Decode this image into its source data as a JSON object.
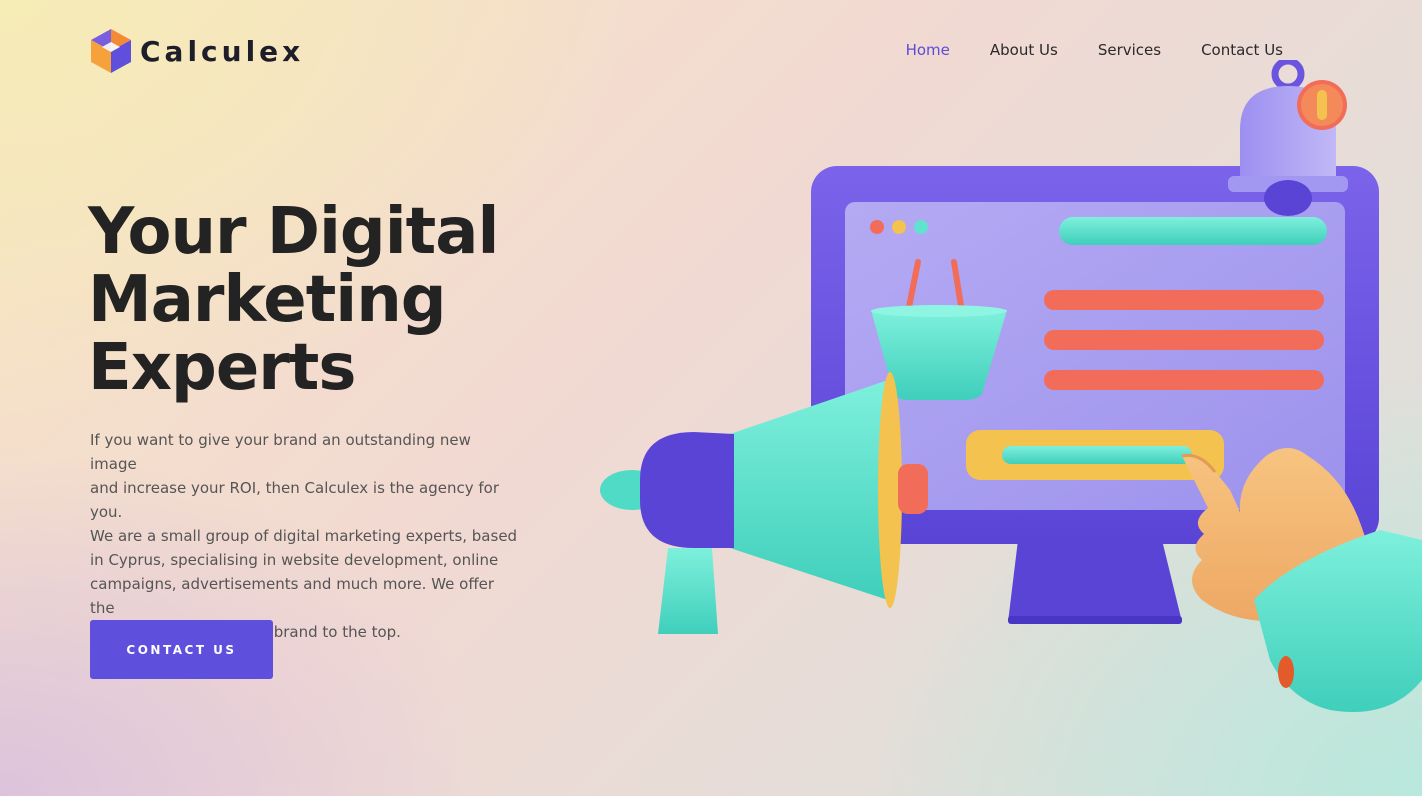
{
  "brand": {
    "name": "Calculex",
    "logo_icon": "hexagon-cube-icon"
  },
  "nav": {
    "items": [
      {
        "label": "Home",
        "active": true
      },
      {
        "label": "About Us",
        "active": false
      },
      {
        "label": "Services",
        "active": false
      },
      {
        "label": "Contact Us",
        "active": false
      }
    ]
  },
  "hero": {
    "title_lines": [
      "Your Digital",
      "Marketing",
      "Experts"
    ],
    "body_lines": [
      "If you want to give your brand an outstanding new image",
      "and increase your ROI, then Calculex is the agency for you.",
      "We are a small group of digital marketing experts, based",
      "in Cyprus, specialising in website development, online",
      "campaigns, advertisements and much more. We offer the",
      "full package to get your brand to the top."
    ],
    "cta_label": "CONTACT US"
  },
  "colors": {
    "accent": "#5e4fdc",
    "nav_active": "#5b4bd8",
    "teal": "#5fe3cf",
    "coral": "#f26c5a",
    "yellow": "#f3c24f",
    "lavender": "#a79cf0"
  }
}
